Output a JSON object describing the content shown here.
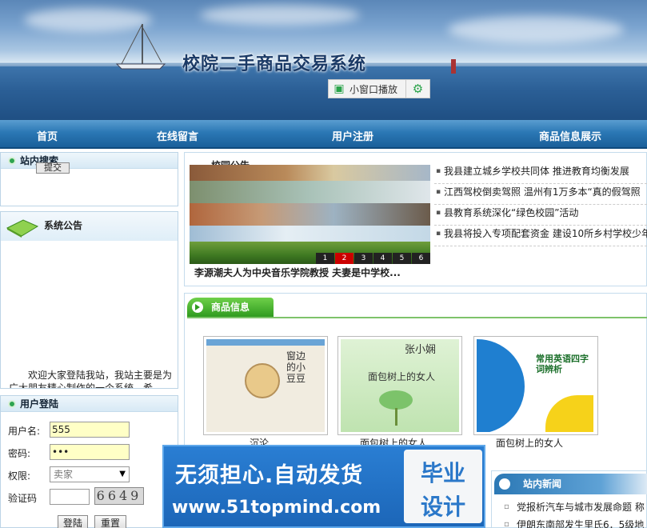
{
  "header": {
    "site_title": "校院二手商品交易系统",
    "mini_play_label": "小窗口播放"
  },
  "nav": [
    "首页",
    "在线留言",
    "用户注册",
    "商品信息展示"
  ],
  "search": {
    "title": "站内搜索",
    "button": "提交"
  },
  "notice": {
    "title": "系统公告",
    "text": "欢迎大家登陆我站，我站主要是为广大朋友精心制作的一个系统，希"
  },
  "login": {
    "title": "用户登陆",
    "username_label": "用户名:",
    "username_value": "555",
    "password_label": "密码:",
    "password_value": "•••",
    "role_label": "权限:",
    "role_value": "卖家",
    "captcha_label": "验证码",
    "captcha_value": "6649",
    "login_button": "登陆",
    "reset_button": "重置"
  },
  "school_news": {
    "title": "校园公告",
    "caption": "李源潮夫人为中央音乐学院教授  夫妻是中学校...",
    "slide_pages": [
      "1",
      "2",
      "3",
      "4",
      "5",
      "6"
    ],
    "active_page": "2",
    "headlines": [
      "我县建立城乡学校共同体  推进教育均衡发展",
      "江西驾校倒卖驾照  温州有1万多本“真的假驾照",
      "县教育系统深化“绿色校园”活动",
      "我县将投入专项配套资金  建设10所乡村学校少年"
    ]
  },
  "products": {
    "title": "商品信息",
    "items": [
      {
        "name": "沉沦",
        "cover_title": "窗边的小豆豆"
      },
      {
        "name": "面包树上的女人",
        "cover_title": "面包树上的女人",
        "cover_author": "张小娴"
      },
      {
        "name": "面包树上的女人",
        "cover_title": "常用英语四字词辨析"
      }
    ]
  },
  "ad": {
    "line1": "无须担心.自动发货",
    "line2": "www.51topmind.com",
    "badge_top": "毕业",
    "badge_bottom": "设计"
  },
  "site_news": {
    "title": "站内新闻",
    "items": [
      "党报析汽车与城市发展命题  称",
      "伊朗东南部发生里氏6．5级地"
    ]
  }
}
